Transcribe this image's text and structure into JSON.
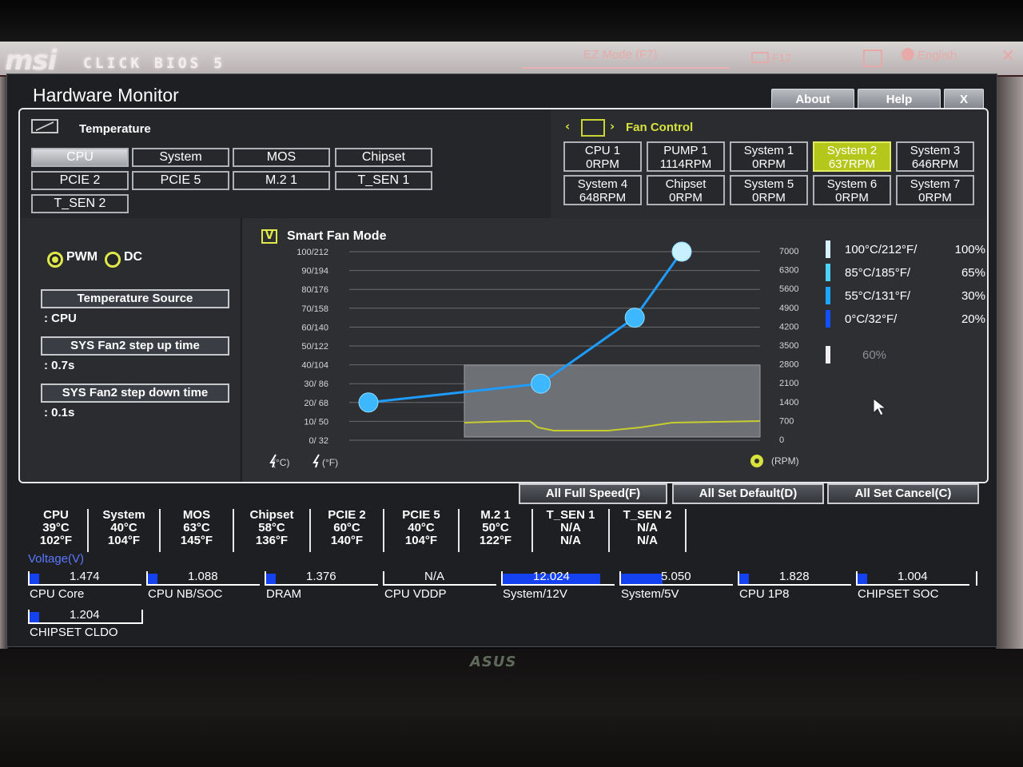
{
  "bios": {
    "brand": "msi",
    "product": "CLICK BIOS 5",
    "ez_mode": "EZ Mode (F7)",
    "f12": "F12",
    "language": "English",
    "monitor_brand": "ASUS"
  },
  "window": {
    "title": "Hardware Monitor",
    "about": "About",
    "help": "Help",
    "close": "X"
  },
  "temperature": {
    "title": "Temperature",
    "sources": [
      "CPU",
      "System",
      "MOS",
      "Chipset",
      "PCIE 2",
      "PCIE 5",
      "M.2 1",
      "T_SEN 1",
      "T_SEN 2"
    ],
    "selected": "CPU"
  },
  "fan_control": {
    "title": "Fan Control",
    "fans": [
      {
        "name": "CPU 1",
        "rpm": "0RPM"
      },
      {
        "name": "PUMP 1",
        "rpm": "1114RPM"
      },
      {
        "name": "System 1",
        "rpm": "0RPM"
      },
      {
        "name": "System 2",
        "rpm": "637RPM"
      },
      {
        "name": "System 3",
        "rpm": "646RPM"
      },
      {
        "name": "System 4",
        "rpm": "648RPM"
      },
      {
        "name": "Chipset",
        "rpm": "0RPM"
      },
      {
        "name": "System 5",
        "rpm": "0RPM"
      },
      {
        "name": "System 6",
        "rpm": "0RPM"
      },
      {
        "name": "System 7",
        "rpm": "0RPM"
      }
    ],
    "selected": "System 2"
  },
  "controls": {
    "pwm": "PWM",
    "dc": "DC",
    "mode": "PWM",
    "temperature_source_label": "Temperature Source",
    "temperature_source_value": ": CPU",
    "step_up_label": "SYS Fan2 step up time",
    "step_up_value": ": 0.7s",
    "step_down_label": "SYS Fan2 step down time",
    "step_down_value": ": 0.1s"
  },
  "graph": {
    "smart_fan_mode": "Smart Fan Mode",
    "smart_fan_checked": true,
    "checkmark": "V",
    "y_left_ticks": [
      "100/212",
      "90/194",
      "80/176",
      "70/158",
      "60/140",
      "50/122",
      "40/104",
      "30/ 86",
      "20/ 68",
      "10/ 50",
      "0/ 32"
    ],
    "y_right_ticks": [
      "7000",
      "6300",
      "5600",
      "4900",
      "4200",
      "3500",
      "2800",
      "2100",
      "1400",
      "700",
      "0"
    ],
    "celsius_label": "(°C)",
    "fahrenheit_label": "(°F)",
    "rpm_label": "(RPM)",
    "curve_points": [
      {
        "temp_c": 0,
        "percent": 20
      },
      {
        "temp_c": 55,
        "percent": 30
      },
      {
        "temp_c": 85,
        "percent": 65
      },
      {
        "temp_c": 100,
        "percent": 100
      }
    ],
    "legend": [
      {
        "temp": "100°C/212°F/",
        "percent": "100%",
        "color": "#d6f4ff"
      },
      {
        "temp": "85°C/185°F/",
        "percent": "65%",
        "color": "#4dd2ff"
      },
      {
        "temp": "55°C/131°F/",
        "percent": "30%",
        "color": "#1aa8ff"
      },
      {
        "temp": "0°C/32°F/",
        "percent": "20%",
        "color": "#1050ff"
      }
    ],
    "current_percent": "60%",
    "curve_color": "#1e9cff",
    "point_color": "#3db8ff",
    "last_point_color": "#c8f0ff"
  },
  "actions": {
    "full_speed": "All Full Speed(F)",
    "set_default": "All Set Default(D)",
    "set_cancel": "All Set Cancel(C)"
  },
  "sensors": [
    {
      "name": "CPU",
      "c": "39°C",
      "f": "102°F"
    },
    {
      "name": "System",
      "c": "40°C",
      "f": "104°F"
    },
    {
      "name": "MOS",
      "c": "63°C",
      "f": "145°F"
    },
    {
      "name": "Chipset",
      "c": "58°C",
      "f": "136°F"
    },
    {
      "name": "PCIE 2",
      "c": "60°C",
      "f": "140°F"
    },
    {
      "name": "PCIE 5",
      "c": "40°C",
      "f": "104°F"
    },
    {
      "name": "M.2 1",
      "c": "50°C",
      "f": "122°F"
    },
    {
      "name": "T_SEN 1",
      "c": "N/A",
      "f": "N/A"
    },
    {
      "name": "T_SEN 2",
      "c": "N/A",
      "f": "N/A"
    }
  ],
  "voltage": {
    "title": "Voltage(V)",
    "items": [
      {
        "value": "1.474",
        "label": "CPU Core",
        "level": 0.06
      },
      {
        "value": "1.088",
        "label": "CPU NB/SOC",
        "level": 0.05
      },
      {
        "value": "1.376",
        "label": "DRAM",
        "level": 0.06
      },
      {
        "value": "N/A",
        "label": "CPU VDDP",
        "level": 0
      },
      {
        "value": "12.024",
        "label": "System/12V",
        "level": 1.0
      },
      {
        "value": "5.050",
        "label": "System/5V",
        "level": 0.43
      },
      {
        "value": "1.828",
        "label": "CPU 1P8",
        "level": 0.1
      },
      {
        "value": "1.004",
        "label": "CHIPSET SOC",
        "level": 0.05
      },
      {
        "value": "1.204",
        "label": "CHIPSET CLDO",
        "level": 0.05
      }
    ]
  }
}
